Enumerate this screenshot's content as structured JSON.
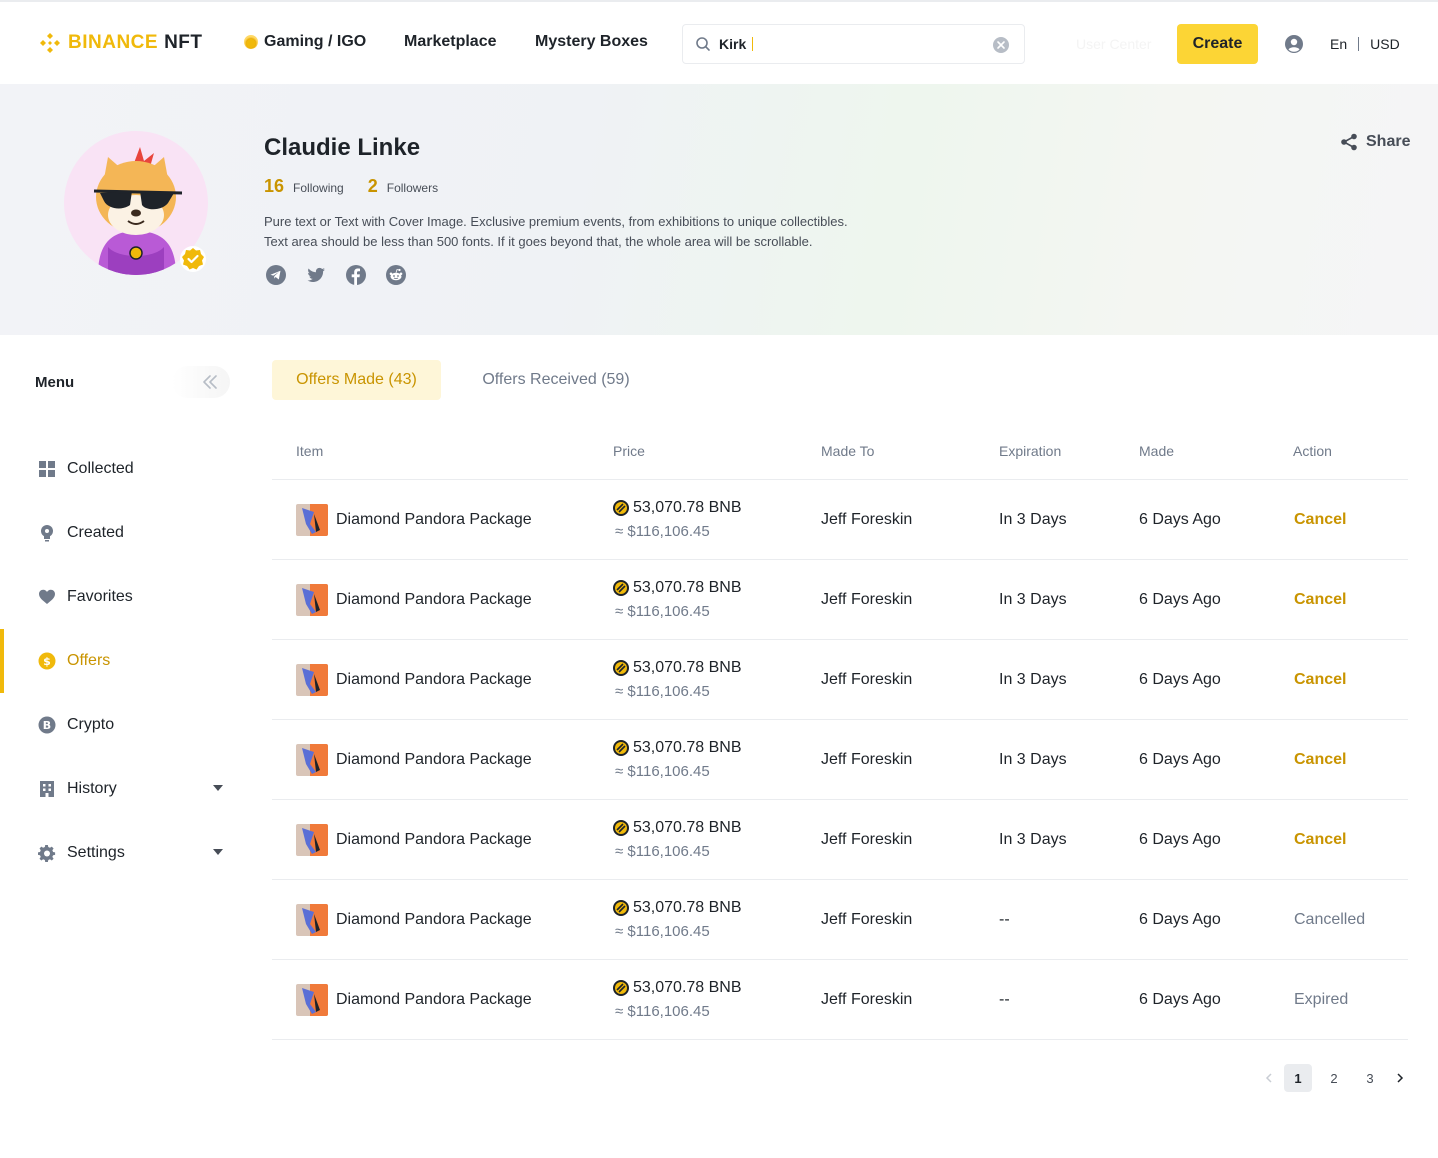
{
  "header": {
    "logo_brand": "BINANCE",
    "logo_product": "NFT",
    "nav": [
      {
        "label": "Gaming / IGO"
      },
      {
        "label": "Marketplace"
      },
      {
        "label": "Mystery Boxes"
      }
    ],
    "search_value": "Kirk",
    "user_center": "User Center",
    "create_label": "Create",
    "language": "En",
    "currency": "USD"
  },
  "profile": {
    "name": "Claudie Linke",
    "following_count": "16",
    "following_label": "Following",
    "followers_count": "2",
    "followers_label": "Followers",
    "bio_line1": "Pure text or Text with Cover Image. Exclusive premium events, from exhibitions to unique collectibles.",
    "bio_line2": "Text area should be less than 500 fonts. If it goes beyond that, the whole area will be scrollable.",
    "share_label": "Share",
    "socials": [
      "telegram-icon",
      "twitter-icon",
      "facebook-icon",
      "reddit-icon"
    ]
  },
  "sidebar": {
    "title": "Menu",
    "items": [
      {
        "label": "Collected",
        "icon": "grid-icon"
      },
      {
        "label": "Created",
        "icon": "bulb-icon"
      },
      {
        "label": "Favorites",
        "icon": "heart-icon"
      },
      {
        "label": "Offers",
        "icon": "dollar-icon",
        "active": true
      },
      {
        "label": "Crypto",
        "icon": "bitcoin-icon"
      },
      {
        "label": "History",
        "icon": "building-icon",
        "expandable": true
      },
      {
        "label": "Settings",
        "icon": "gear-icon",
        "expandable": true
      }
    ]
  },
  "tabs": {
    "made": "Offers Made (43)",
    "received": "Offers Received (59)"
  },
  "table": {
    "headers": {
      "item": "Item",
      "price": "Price",
      "made_to": "Made To",
      "expiration": "Expiration",
      "made": "Made",
      "action": "Action"
    },
    "rows": [
      {
        "item": "Diamond Pandora Package",
        "price_bnb": "53,070.78 BNB",
        "price_usd": "≈ $116,106.45",
        "made_to": "Jeff Foreskin",
        "expiration": "In 3 Days",
        "made": "6 Days Ago",
        "action": "Cancel"
      },
      {
        "item": "Diamond Pandora Package",
        "price_bnb": "53,070.78 BNB",
        "price_usd": "≈ $116,106.45",
        "made_to": "Jeff Foreskin",
        "expiration": "In 3 Days",
        "made": "6 Days Ago",
        "action": "Cancel"
      },
      {
        "item": "Diamond Pandora Package",
        "price_bnb": "53,070.78 BNB",
        "price_usd": "≈ $116,106.45",
        "made_to": "Jeff Foreskin",
        "expiration": "In 3 Days",
        "made": "6 Days Ago",
        "action": "Cancel"
      },
      {
        "item": "Diamond Pandora Package",
        "price_bnb": "53,070.78 BNB",
        "price_usd": "≈ $116,106.45",
        "made_to": "Jeff Foreskin",
        "expiration": "In 3 Days",
        "made": "6 Days Ago",
        "action": "Cancel"
      },
      {
        "item": "Diamond Pandora Package",
        "price_bnb": "53,070.78 BNB",
        "price_usd": "≈ $116,106.45",
        "made_to": "Jeff Foreskin",
        "expiration": "In 3 Days",
        "made": "6 Days Ago",
        "action": "Cancel"
      },
      {
        "item": "Diamond Pandora Package",
        "price_bnb": "53,070.78 BNB",
        "price_usd": "≈ $116,106.45",
        "made_to": "Jeff Foreskin",
        "expiration": "--",
        "made": "6 Days Ago",
        "action": "Cancelled"
      },
      {
        "item": "Diamond Pandora Package",
        "price_bnb": "53,070.78 BNB",
        "price_usd": "≈ $116,106.45",
        "made_to": "Jeff Foreskin",
        "expiration": "--",
        "made": "6 Days Ago",
        "action": "Expired"
      }
    ]
  },
  "pagination": {
    "pages": [
      "1",
      "2",
      "3"
    ],
    "current": "1"
  },
  "colors": {
    "accent": "#F0B90B",
    "accent_text": "#C99400",
    "create_button": "#FCD535",
    "tab_active_bg": "#FEF6D8"
  }
}
